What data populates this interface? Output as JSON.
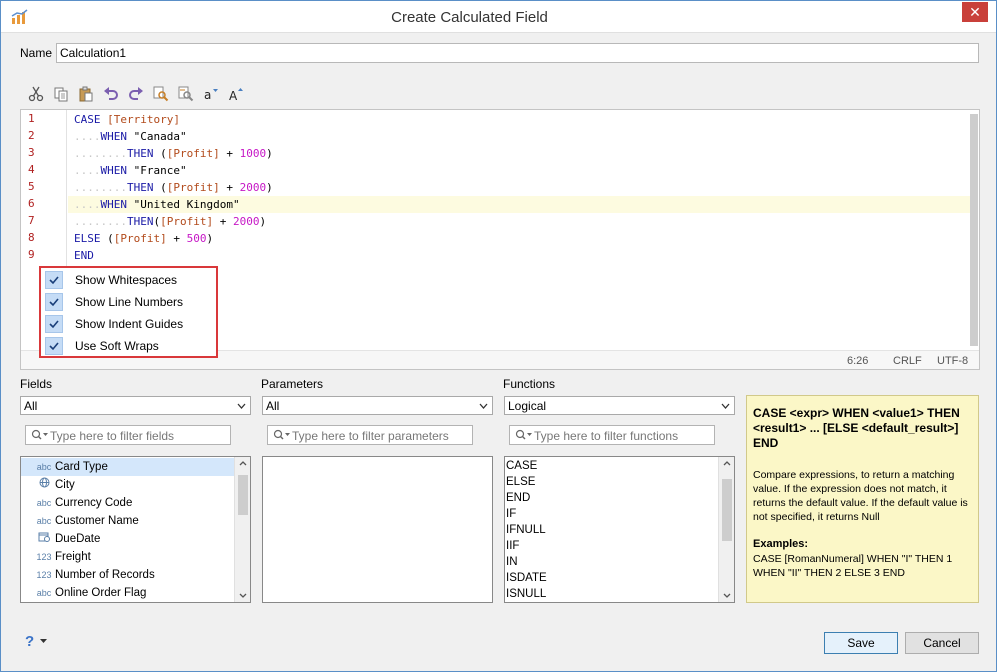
{
  "window": {
    "title": "Create Calculated Field",
    "close_glyph": "✕"
  },
  "name": {
    "label": "Name",
    "value": "Calculation1"
  },
  "toolbar": {
    "icons": [
      "cut-icon",
      "copy-icon",
      "paste-icon",
      "undo-icon",
      "redo-icon",
      "find-icon",
      "replace-icon",
      "lowercase-icon",
      "uppercase-icon"
    ],
    "lowercase_label": "a",
    "uppercase_label": "A"
  },
  "editor": {
    "line_numbers": [
      "1",
      "2",
      "3",
      "4",
      "5",
      "6",
      "7",
      "8",
      "9"
    ],
    "current_line": 6,
    "status": {
      "position": "6:26",
      "line_ending": "CRLF",
      "encoding": "UTF-8"
    },
    "code": {
      "l1_kw": "CASE",
      "l1_fld": "[Territory]",
      "l2_ws": "....",
      "l2_kw": "WHEN",
      "l2_str": "\"Canada\"",
      "l3_ws": "........",
      "l3_kw": "THEN",
      "l3_a": "(",
      "l3_fld": "[Profit]",
      "l3_b": "+",
      "l3_num": "1000",
      "l3_c": ")",
      "l4_ws": "....",
      "l4_kw": "WHEN",
      "l4_str": "\"France\"",
      "l5_ws": "........",
      "l5_kw": "THEN",
      "l5_a": "(",
      "l5_fld": "[Profit]",
      "l5_b": "+",
      "l5_num": "2000",
      "l5_c": ")",
      "l6_ws": "....",
      "l6_kw": "WHEN",
      "l6_str": "\"United Kingdom\"",
      "l7_ws": "........",
      "l7_kw": "THEN",
      "l7_a": "(",
      "l7_fld": "[Profit]",
      "l7_b": "+",
      "l7_num": "2000",
      "l7_c": ")",
      "l8_kw": "ELSE",
      "l8_a": "(",
      "l8_fld": "[Profit]",
      "l8_b": "+",
      "l8_num": "500",
      "l8_c": ")",
      "l9_kw": "END"
    }
  },
  "view_options": [
    {
      "label": "Show Whitespaces",
      "checked": true
    },
    {
      "label": "Show Line Numbers",
      "checked": true
    },
    {
      "label": "Show Indent Guides",
      "checked": true
    },
    {
      "label": "Use Soft Wraps",
      "checked": true
    }
  ],
  "fields": {
    "label": "Fields",
    "selected": "All",
    "filter_placeholder": "Type here to filter fields",
    "items": [
      {
        "icon": "abc",
        "label": "Card Type"
      },
      {
        "icon": "globe",
        "label": "City"
      },
      {
        "icon": "abc",
        "label": "Currency Code"
      },
      {
        "icon": "abc",
        "label": "Customer Name"
      },
      {
        "icon": "calendar",
        "label": "DueDate"
      },
      {
        "icon": "123",
        "label": "Freight"
      },
      {
        "icon": "123",
        "label": "Number of Records"
      },
      {
        "icon": "abc",
        "label": "Online Order Flag"
      }
    ]
  },
  "parameters": {
    "label": "Parameters",
    "selected": "All",
    "filter_placeholder": "Type here to filter parameters"
  },
  "functions": {
    "label": "Functions",
    "selected": "Logical",
    "filter_placeholder": "Type here to filter functions",
    "items": [
      "CASE",
      "ELSE",
      "END",
      "IF",
      "IFNULL",
      "IIF",
      "IN",
      "ISDATE",
      "ISNULL"
    ]
  },
  "help": {
    "syntax": "CASE <expr> WHEN <value1> THEN <result1> ... [ELSE <default_result>] END",
    "description": "Compare expressions, to return a matching value. If the expression does not match, it returns the default value. If the default value is not specified, it returns Null",
    "examples_title": "Examples:",
    "example": "CASE [RomanNumeral] WHEN \"I\" THEN 1 WHEN \"II\" THEN 2 ELSE 3 END"
  },
  "footer": {
    "help_glyph": "?",
    "save_label": "Save",
    "cancel_label": "Cancel"
  }
}
